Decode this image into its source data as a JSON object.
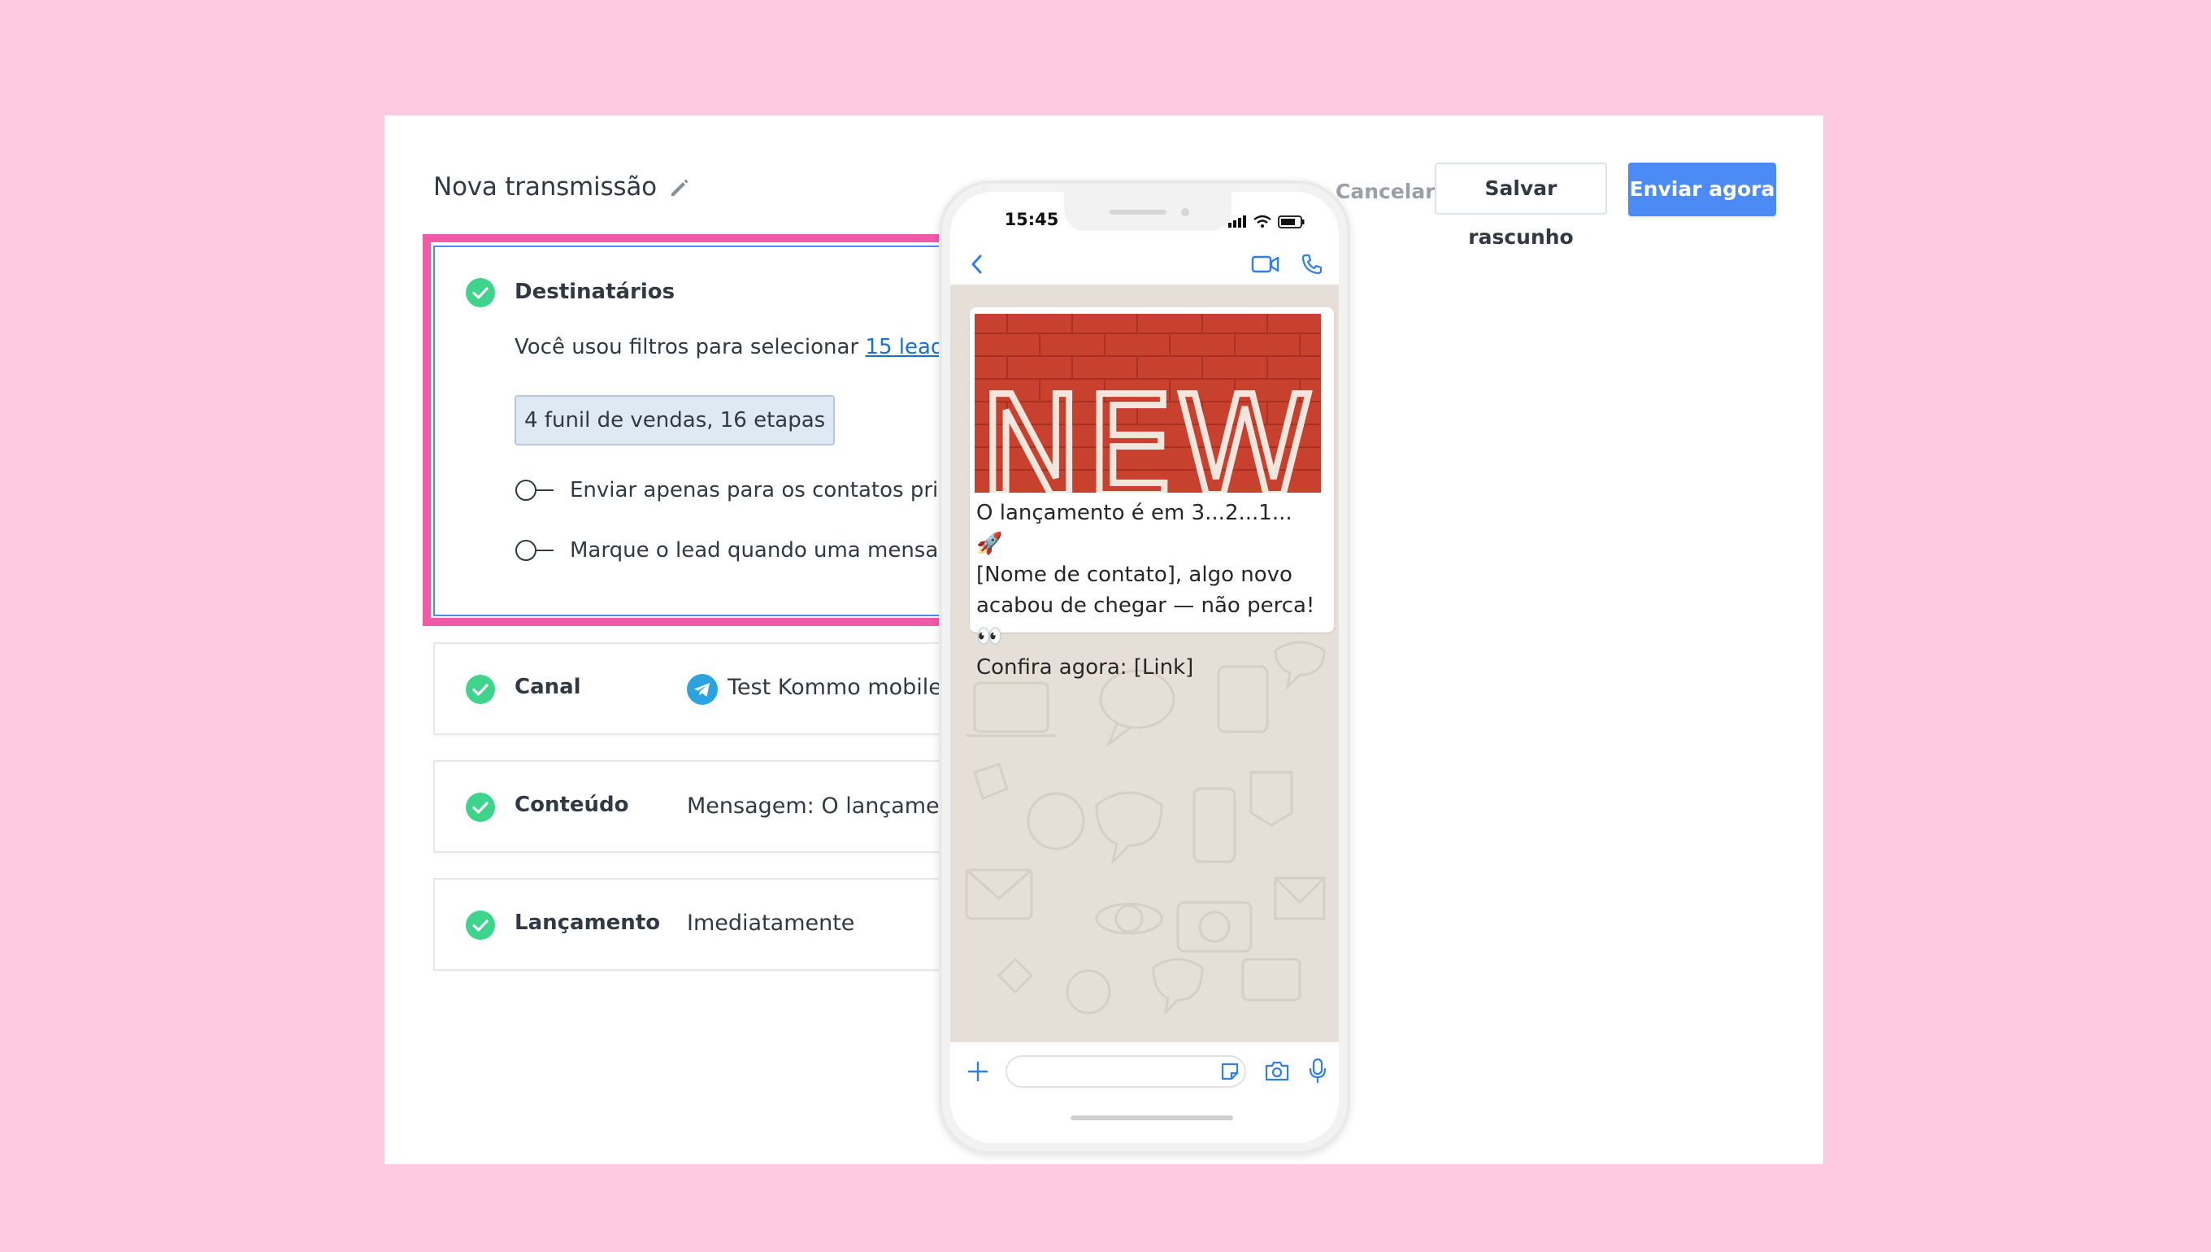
{
  "header": {
    "title": "Nova transmissão",
    "cancel_label": "Cancelar",
    "draft_label": "Salvar rascunho",
    "send_label": "Enviar agora"
  },
  "recipients": {
    "label": "Destinatários",
    "filter_prefix": "Você usou filtros para selecionar ",
    "filter_link": "15 leads",
    "tag": "4 funil de vendas, 16 etapas",
    "toggle_main_contacts": "Enviar apenas para os contatos principais",
    "toggle_mark_lead": "Marque o lead quando uma mensagem não for enviada"
  },
  "channel": {
    "label": "Canal",
    "value": "Test Kommo mobile"
  },
  "content": {
    "label": "Conteúdo",
    "value": "Mensagem: O lançamento é em 3...2...1... 🚀 [..."
  },
  "launch": {
    "label": "Lançamento",
    "value": "Imediatamente"
  },
  "phone": {
    "time": "15:45",
    "image_text": "NEW",
    "message": "O lançamento é em 3...2...1... 🚀\n[Nome de contato], algo novo\nacabou de chegar — não perca! 👀\nConfira agora: [Link]"
  },
  "colors": {
    "background": "#ffc9e1",
    "highlight": "#f05ba7",
    "accent": "#4c8bf5",
    "check": "#3fd48c",
    "link": "#1b6fd1",
    "brick": "#c8402e"
  },
  "icons": [
    "pencil-icon",
    "check-icon",
    "chevron-down-icon",
    "chevron-right-icon",
    "help-icon",
    "toggle-icon",
    "telegram-icon",
    "back-icon",
    "video-icon",
    "phone-icon",
    "plus-icon",
    "sticker-icon",
    "camera-icon",
    "mic-icon"
  ]
}
